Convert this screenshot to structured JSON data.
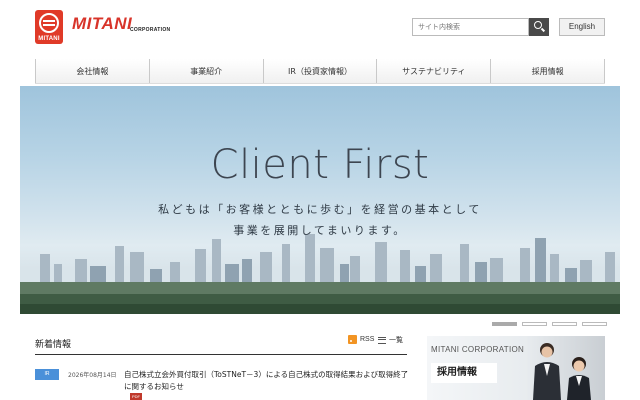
{
  "header": {
    "logo_word": "MITANI",
    "logo_corp": "CORPORATION",
    "logo_mark_text": "MITANI",
    "search_placeholder": "サイト内検索",
    "search_icon": "search-icon",
    "lang_label": "English"
  },
  "nav": {
    "items": [
      {
        "label": "会社情報"
      },
      {
        "label": "事業紹介"
      },
      {
        "label": "IR（投資家情報）"
      },
      {
        "label": "サステナビリティ"
      },
      {
        "label": "採用情報"
      }
    ]
  },
  "hero": {
    "title": "Client First",
    "line1": "私どもは「お客様とともに歩む」を経営の基本として",
    "line2": "事業を展開してまいります。",
    "slide_count": 4,
    "active_slide": 1
  },
  "news": {
    "title": "新着情報",
    "rss_label": "RSS",
    "list_label": "一覧",
    "items": [
      {
        "tag": "IR",
        "date": "2026年08月14日",
        "text": "自己株式立会外買付取引（ToSTNeT－3）による自己株式の取得結果および取得終了に関するお知らせ",
        "file_type": "PDF"
      }
    ]
  },
  "recruit": {
    "corp": "MITANI CORPORATION",
    "title": "採用情報"
  },
  "colors": {
    "brand_red": "#d8342a",
    "tag_blue": "#4a90d9",
    "rss_orange": "#f29423"
  }
}
